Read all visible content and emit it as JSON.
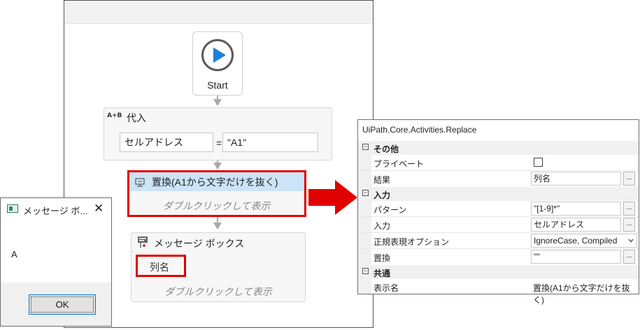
{
  "designer": {
    "start_label": "Start",
    "assign": {
      "icon_text": "A+B",
      "title": "代入",
      "left_value": "セルアドレス",
      "equals": "=",
      "right_value": "\"A1\""
    },
    "replace": {
      "title": "置換(A1から文字だけを抜く)",
      "hint": "ダブルクリックして表示"
    },
    "message_box": {
      "title": "メッセージ ボックス",
      "text_value": "列名",
      "hint": "ダブルクリックして表示"
    }
  },
  "properties": {
    "title": "UiPath.Core.Activities.Replace",
    "categories": [
      {
        "label": "その他"
      },
      {
        "label": "入力"
      },
      {
        "label": "共通"
      }
    ],
    "rows": {
      "private": {
        "name": "プライベート",
        "checked": false
      },
      "result": {
        "name": "結果",
        "value": "列名"
      },
      "pattern": {
        "name": "パターン",
        "value": "\"[1-9]*\""
      },
      "input": {
        "name": "入力",
        "value": "セルアドレス"
      },
      "regex_option": {
        "name": "正規表現オプション",
        "value": "IgnoreCase, Compiled"
      },
      "replacement": {
        "name": "置換",
        "value": "\"\""
      },
      "display_name": {
        "name": "表示名",
        "value": "置換(A1から文字だけを抜く)"
      }
    },
    "ellipsis": "...",
    "dropdown_icon": "chevron-down"
  },
  "dialog": {
    "title": "メッセージ ボ...",
    "close_glyph": "✕",
    "message": "A",
    "ok_label": "OK"
  },
  "colors": {
    "highlight_red": "#e00000",
    "selected_activity": "#cce4f7",
    "play_blue": "#1e7fd8"
  }
}
